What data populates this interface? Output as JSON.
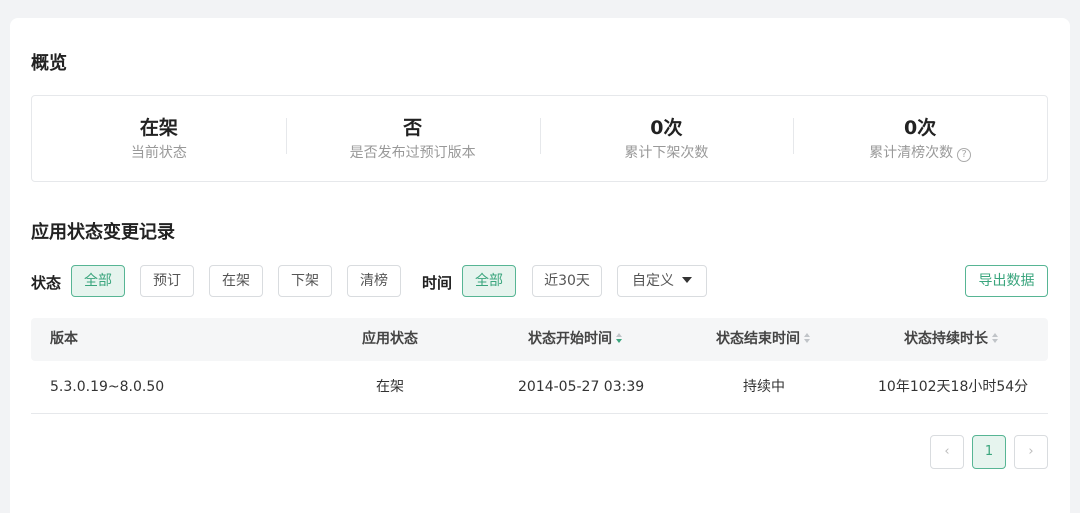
{
  "overview": {
    "title": "概览",
    "stats": [
      {
        "value": "在架",
        "label": "当前状态"
      },
      {
        "value": "否",
        "label": "是否发布过预订版本"
      },
      {
        "value": "0次",
        "label": "累计下架次数"
      },
      {
        "value": "0次",
        "label": "累计清榜次数"
      }
    ],
    "help_icon": "question-circle-icon",
    "help_glyph": "?"
  },
  "records": {
    "title": "应用状态变更记录",
    "status_filter": {
      "label": "状态",
      "options": [
        "全部",
        "预订",
        "在架",
        "下架",
        "清榜"
      ],
      "selected": "全部"
    },
    "time_filter": {
      "label": "时间",
      "options": [
        "全部",
        "近30天",
        "自定义"
      ],
      "selected": "全部"
    },
    "export_label": "导出数据"
  },
  "table": {
    "columns": [
      "版本",
      "应用状态",
      "状态开始时间",
      "状态结束时间",
      "状态持续时长"
    ],
    "rows": [
      [
        "5.3.0.19~8.0.50",
        "在架",
        "2014-05-27 03:39",
        "持续中",
        "10年102天18小时54分"
      ]
    ]
  },
  "pagination": {
    "prev": "‹",
    "current": "1",
    "next": "›"
  },
  "colors": {
    "accent": "#3aa57d",
    "accent_bg": "#e6f4ee",
    "border": "#e6e8eb"
  }
}
